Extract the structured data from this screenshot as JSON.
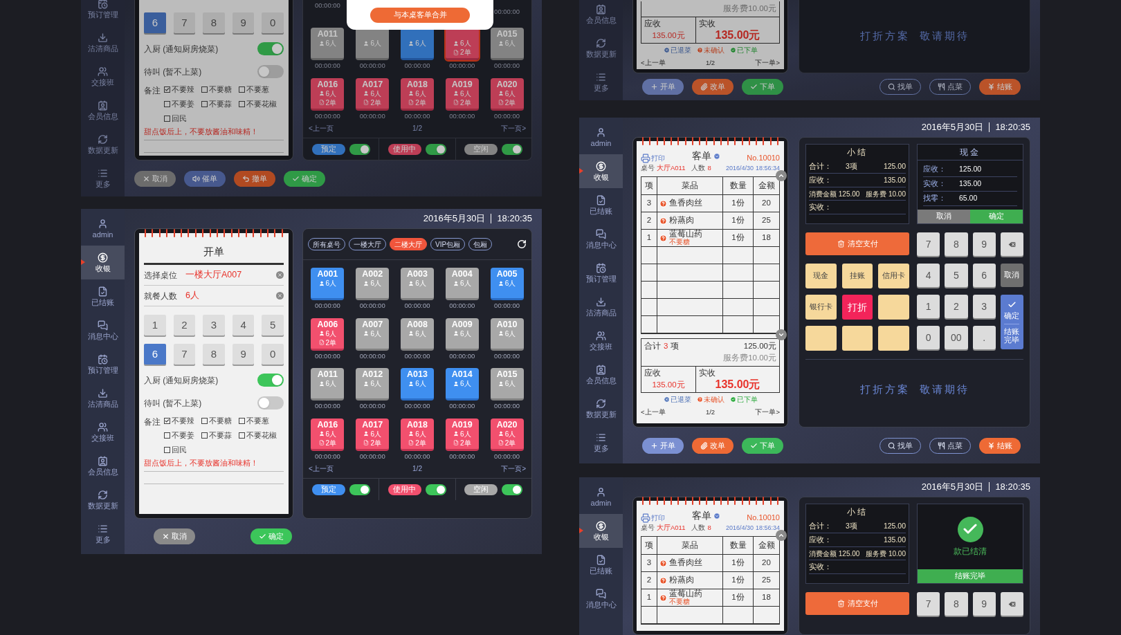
{
  "screens": [
    {
      "kind": "open_order",
      "dimmed": true,
      "sidebar": [
        {
          "kind": "reservation",
          "label": "预订管理",
          "selected": false
        },
        {
          "kind": "clean",
          "label": "沽清商品",
          "selected": false
        },
        {
          "kind": "shift",
          "label": "交接班",
          "selected": false
        },
        {
          "kind": "member",
          "label": "会员信息",
          "selected": false
        },
        {
          "kind": "sync",
          "label": "数据更新",
          "selected": false
        },
        {
          "kind": "more",
          "label": "更多",
          "selected": false
        }
      ],
      "form": {
        "keypad": [
          {
            "label": "6",
            "selected": true
          },
          {
            "label": "7",
            "selected": false
          },
          {
            "label": "8",
            "selected": false
          },
          {
            "label": "9",
            "selected": false
          },
          {
            "label": "0",
            "selected": false
          }
        ],
        "toggles": [
          {
            "label": "入厨 (通知厨房烧菜)",
            "on": true
          },
          {
            "label": "待叫 (暂不上菜)",
            "on": false
          }
        ],
        "remarks": {
          "label": "备注",
          "options": [
            {
              "label": "不要辣",
              "checked": true
            },
            {
              "label": "不要糖",
              "checked": false
            },
            {
              "label": "不要葱",
              "checked": false
            },
            {
              "label": "不要姜",
              "checked": false
            },
            {
              "label": "不要蒜",
              "checked": false
            },
            {
              "label": "不要花椒",
              "checked": false
            },
            {
              "label": "回民",
              "checked": false
            }
          ],
          "note": "甜点饭后上，不要放酱油和味精！"
        }
      },
      "grid": {
        "cut_row": {
          "left_timer": "00:00:00",
          "right_timer": "00:00:00"
        },
        "tiles": [
          {
            "code": "A011",
            "kind": "idle",
            "guests": "6人",
            "timer": "00:00:00",
            "selected": false
          },
          {
            "kind": "idle",
            "guests": "6人",
            "timer": "00:00:00",
            "selected": false
          },
          {
            "kind": "reserved",
            "guests": "6人",
            "timer": "00:00:00",
            "selected": false
          },
          {
            "kind": "in_use",
            "guests": "6人",
            "orders": "2单",
            "timer": "00:00:00",
            "selected": true
          },
          {
            "code": "A015",
            "kind": "idle",
            "guests": "6人",
            "timer": "00:00:00",
            "selected": false
          },
          {
            "code": "A016",
            "kind": "in_use",
            "guests": "6人",
            "orders": "2单",
            "timer": "00:00:00",
            "selected": false
          },
          {
            "code": "A017",
            "kind": "in_use",
            "guests": "6人",
            "orders": "2单",
            "timer": "00:00:00",
            "selected": false
          },
          {
            "code": "A018",
            "kind": "in_use",
            "guests": "6人",
            "orders": "2单",
            "timer": "00:00:00",
            "selected": false
          },
          {
            "code": "A019",
            "kind": "in_use",
            "guests": "6人",
            "orders": "2单",
            "timer": "00:00:00",
            "selected": false
          },
          {
            "code": "A020",
            "kind": "in_use",
            "guests": "6人",
            "orders": "2单",
            "timer": "00:00:00",
            "selected": false
          }
        ],
        "pager": {
          "prev": "<上一页",
          "page": "1/2",
          "next": "下一页>"
        },
        "legend": [
          {
            "kind": "reserved",
            "label": "预定",
            "on": true
          },
          {
            "kind": "in_use",
            "label": "使用中",
            "on": true
          },
          {
            "kind": "idle",
            "label": "空闲",
            "on": true
          }
        ],
        "popup": {
          "button": "与本桌客单合并"
        }
      },
      "actions": [
        {
          "kind": "cancel",
          "label": "取消"
        },
        {
          "kind": "urge",
          "label": "催单"
        },
        {
          "kind": "revoke",
          "label": "撤单"
        },
        {
          "kind": "confirm",
          "label": "确定"
        }
      ]
    },
    {
      "kind": "open_order",
      "dimmed": false,
      "header": {
        "date": "2016年5月30日",
        "time": "18:20:35"
      },
      "sidebar": [
        {
          "kind": "user",
          "label": "admin",
          "selected": false
        },
        {
          "kind": "cashier",
          "label": "收银",
          "selected": true
        },
        {
          "kind": "settled",
          "label": "已结账",
          "selected": false
        },
        {
          "kind": "messages",
          "label": "消息中心",
          "selected": false
        },
        {
          "kind": "reservation",
          "label": "预订管理",
          "selected": false
        },
        {
          "kind": "clean",
          "label": "沽清商品",
          "selected": false
        },
        {
          "kind": "shift",
          "label": "交接班",
          "selected": false
        },
        {
          "kind": "member",
          "label": "会员信息",
          "selected": false
        },
        {
          "kind": "sync",
          "label": "数据更新",
          "selected": false
        },
        {
          "kind": "more",
          "label": "更多",
          "selected": false
        }
      ],
      "form": {
        "title": "开单",
        "fields": [
          {
            "label": "选择桌位",
            "value": "一楼大厅A007"
          },
          {
            "label": "就餐人数",
            "value": "6人"
          }
        ],
        "keypad": [
          {
            "label": "1",
            "selected": false
          },
          {
            "label": "2",
            "selected": false
          },
          {
            "label": "3",
            "selected": false
          },
          {
            "label": "4",
            "selected": false
          },
          {
            "label": "5",
            "selected": false
          },
          {
            "label": "6",
            "selected": true
          },
          {
            "label": "7",
            "selected": false
          },
          {
            "label": "8",
            "selected": false
          },
          {
            "label": "9",
            "selected": false
          },
          {
            "label": "0",
            "selected": false
          }
        ],
        "toggles": [
          {
            "label": "入厨 (通知厨房烧菜)",
            "on": true
          },
          {
            "label": "待叫 (暂不上菜)",
            "on": false
          }
        ],
        "remarks": {
          "label": "备注",
          "options": [
            {
              "label": "不要辣",
              "checked": true
            },
            {
              "label": "不要糖",
              "checked": false
            },
            {
              "label": "不要葱",
              "checked": false
            },
            {
              "label": "不要姜",
              "checked": false
            },
            {
              "label": "不要蒜",
              "checked": false
            },
            {
              "label": "不要花椒",
              "checked": false
            },
            {
              "label": "回民",
              "checked": false
            }
          ],
          "note": "甜点饭后上，不要放酱油和味精！"
        }
      },
      "grid": {
        "tabs": [
          {
            "label": "所有桌号",
            "selected": false
          },
          {
            "label": "一楼大厅",
            "selected": false
          },
          {
            "label": "二楼大厅",
            "selected": true
          },
          {
            "label": "VIP包厢",
            "selected": false
          },
          {
            "label": "包厢",
            "selected": false
          }
        ],
        "tiles": [
          {
            "code": "A001",
            "kind": "reserved",
            "guests": "6人",
            "timer": "00:00:00",
            "selected": false
          },
          {
            "code": "A002",
            "kind": "idle",
            "guests": "6人",
            "timer": "00:00:00",
            "selected": false
          },
          {
            "code": "A003",
            "kind": "idle",
            "guests": "6人",
            "timer": "00:00:00",
            "selected": false
          },
          {
            "code": "A004",
            "kind": "idle",
            "guests": "6人",
            "timer": "00:00:00",
            "selected": false
          },
          {
            "code": "A005",
            "kind": "reserved",
            "guests": "6人",
            "timer": "00:00:00",
            "selected": false
          },
          {
            "code": "A006",
            "kind": "in_use",
            "guests": "6人",
            "orders": "2单",
            "timer": "00:00:00",
            "selected": false
          },
          {
            "code": "A007",
            "kind": "idle",
            "guests": "6人",
            "timer": "00:00:00",
            "selected": false
          },
          {
            "code": "A008",
            "kind": "idle",
            "guests": "6人",
            "timer": "00:00:00",
            "selected": false
          },
          {
            "code": "A009",
            "kind": "idle",
            "guests": "6人",
            "timer": "00:00:00",
            "selected": false
          },
          {
            "code": "A010",
            "kind": "idle",
            "guests": "6人",
            "timer": "00:00:00",
            "selected": false
          },
          {
            "code": "A011",
            "kind": "idle",
            "guests": "6人",
            "timer": "00:00:00",
            "selected": false
          },
          {
            "code": "A012",
            "kind": "idle",
            "guests": "6人",
            "timer": "00:00:00",
            "selected": false
          },
          {
            "code": "A013",
            "kind": "reserved",
            "guests": "6人",
            "timer": "00:00:00",
            "selected": false
          },
          {
            "code": "A014",
            "kind": "reserved",
            "guests": "6人",
            "timer": "00:00:00",
            "selected": false
          },
          {
            "code": "A015",
            "kind": "idle",
            "guests": "6人",
            "timer": "00:00:00",
            "selected": false
          },
          {
            "code": "A016",
            "kind": "in_use",
            "guests": "6人",
            "orders": "2单",
            "timer": "00:00:00",
            "selected": false
          },
          {
            "code": "A017",
            "kind": "in_use",
            "guests": "6人",
            "orders": "2单",
            "timer": "00:00:00",
            "selected": false
          },
          {
            "code": "A018",
            "kind": "in_use",
            "guests": "6人",
            "orders": "2单",
            "timer": "00:00:00",
            "selected": false
          },
          {
            "code": "A019",
            "kind": "in_use",
            "guests": "6人",
            "orders": "2单",
            "timer": "00:00:00",
            "selected": false
          },
          {
            "code": "A020",
            "kind": "in_use",
            "guests": "6人",
            "orders": "2单",
            "timer": "00:00:00",
            "selected": false
          }
        ],
        "pager": {
          "prev": "<上一页",
          "page": "1/2",
          "next": "下一页>"
        },
        "legend": [
          {
            "kind": "reserved",
            "label": "预定",
            "on": true
          },
          {
            "kind": "in_use",
            "label": "使用中",
            "on": true
          },
          {
            "kind": "idle",
            "label": "空闲",
            "on": true
          }
        ]
      },
      "actions": [
        {
          "kind": "cancel",
          "label": "取消"
        },
        {
          "kind": "confirm",
          "label": "确定"
        }
      ]
    },
    {
      "kind": "checkout",
      "dimmed": true,
      "sidebar": [
        {
          "kind": "member",
          "label": "会员信息",
          "selected": false
        },
        {
          "kind": "sync",
          "label": "数据更新",
          "selected": false
        },
        {
          "kind": "more",
          "label": "更多",
          "selected": false
        }
      ],
      "receipt": {
        "totals": {
          "service_fee": "服务费10.00元"
        },
        "due": {
          "label": "应收",
          "value": "135.00元"
        },
        "paid": {
          "label": "实收",
          "value": "135.00元"
        },
        "legend": [
          {
            "kind": "returned",
            "label": "已退菜"
          },
          {
            "kind": "unconfirmed",
            "label": "未确认"
          },
          {
            "kind": "ordered",
            "label": "已下单"
          }
        ],
        "pager": {
          "prev": "<上一单",
          "page": "1/2",
          "next": "下一单>"
        }
      },
      "promo": [
        "打折方案",
        "敬请期待"
      ],
      "actions_left": [
        {
          "kind": "new",
          "label": "开单"
        },
        {
          "kind": "edit",
          "label": "改单"
        },
        {
          "kind": "submit",
          "label": "下单"
        }
      ],
      "actions_right": [
        {
          "kind": "find",
          "label": "找单"
        },
        {
          "kind": "menu",
          "label": "点菜"
        },
        {
          "kind": "checkout",
          "label": "结账"
        }
      ]
    },
    {
      "kind": "checkout",
      "dimmed": false,
      "header": {
        "date": "2016年5月30日",
        "time": "18:20:35"
      },
      "sidebar": [
        {
          "kind": "user",
          "label": "admin",
          "selected": false
        },
        {
          "kind": "cashier",
          "label": "收银",
          "selected": true
        },
        {
          "kind": "settled",
          "label": "已结账",
          "selected": false
        },
        {
          "kind": "messages",
          "label": "消息中心",
          "selected": false
        },
        {
          "kind": "reservation",
          "label": "预订管理",
          "selected": false
        },
        {
          "kind": "clean",
          "label": "沽清商品",
          "selected": false
        },
        {
          "kind": "shift",
          "label": "交接班",
          "selected": false
        },
        {
          "kind": "member",
          "label": "会员信息",
          "selected": false
        },
        {
          "kind": "sync",
          "label": "数据更新",
          "selected": false
        },
        {
          "kind": "more",
          "label": "更多",
          "selected": false
        }
      ],
      "receipt": {
        "print": "打印",
        "title": "客单",
        "number": "No.10010",
        "meta": {
          "table_label": "桌号",
          "table": "大厅A011",
          "guests_label": "人数",
          "guests": "8",
          "date": "2016/4/30",
          "time": "18:56:34"
        },
        "columns": [
          "项",
          "菜品",
          "数量",
          "金额"
        ],
        "items": [
          {
            "kind": "unconfirmed",
            "index": "3",
            "name": "鱼香肉丝",
            "qty": "1份",
            "amount": "20"
          },
          {
            "kind": "unconfirmed",
            "index": "2",
            "name": "粉蒸肉",
            "qty": "1份",
            "amount": "25"
          },
          {
            "kind": "unconfirmed",
            "index": "1",
            "name": "蓝莓山药",
            "note": "不要糖",
            "qty": "1份",
            "amount": "18"
          },
          {
            "kind": "blank"
          },
          {
            "kind": "blank"
          },
          {
            "kind": "blank"
          },
          {
            "kind": "blank"
          },
          {
            "kind": "blank"
          }
        ],
        "totals": {
          "label": "合计",
          "count": "3",
          "unit": "项",
          "amount": "125.00元",
          "service_fee": "服务费10.00元"
        },
        "due": {
          "label": "应收",
          "value": "135.00元"
        },
        "paid": {
          "label": "实收",
          "value": "135.00元"
        },
        "legend": [
          {
            "kind": "returned",
            "label": "已退菜"
          },
          {
            "kind": "unconfirmed",
            "label": "未确认"
          },
          {
            "kind": "ordered",
            "label": "已下单"
          }
        ],
        "pager": {
          "prev": "<上一单",
          "page": "1/2",
          "next": "下一单>"
        }
      },
      "summary": {
        "title": "小结",
        "rows": [
          {
            "kind": "main",
            "label": "合计：",
            "count": "3项",
            "value": "125.00"
          },
          {
            "kind": "main",
            "label": "应收：",
            "value": "135.00"
          },
          {
            "kind": "detail",
            "label": "消费金额 125.00",
            "value": "服务费 10.00"
          },
          {
            "kind": "main",
            "label": "实收："
          }
        ]
      },
      "payment_panel": {
        "kind": "cash",
        "title": "现金",
        "rows": [
          {
            "label": "应收：",
            "value": "125.00"
          },
          {
            "label": "实收：",
            "value": "135.00"
          },
          {
            "label": "找零：",
            "value": "65.00"
          }
        ],
        "cancel": "取消",
        "confirm": "确定"
      },
      "clear_button": "清空支付",
      "pay_methods": [
        {
          "label": "现金",
          "selected": false
        },
        {
          "label": "挂账",
          "selected": false
        },
        {
          "label": "信用卡",
          "selected": false
        },
        {
          "label": "银行卡",
          "selected": false
        },
        {
          "label": "打折",
          "selected": true
        },
        {
          "selected": false
        },
        {
          "selected": false
        },
        {
          "selected": false
        },
        {
          "selected": false
        }
      ],
      "numpad": [
        {
          "kind": "digit",
          "label": "7"
        },
        {
          "kind": "digit",
          "label": "8"
        },
        {
          "kind": "digit",
          "label": "9"
        },
        {
          "kind": "backspace"
        },
        {
          "kind": "digit",
          "label": "4"
        },
        {
          "kind": "digit",
          "label": "5"
        },
        {
          "kind": "digit",
          "label": "6"
        },
        {
          "kind": "cancel",
          "label": "取消"
        },
        {
          "kind": "digit",
          "label": "1"
        },
        {
          "kind": "digit",
          "label": "2"
        },
        {
          "kind": "digit",
          "label": "3"
        },
        {
          "kind": "digit",
          "label": "0"
        },
        {
          "kind": "digit",
          "label": "00"
        },
        {
          "kind": "digit",
          "label": "."
        },
        {
          "kind": "confirm",
          "label": "确定",
          "sublabel": "结账完毕"
        }
      ],
      "promo": [
        "打折方案",
        "敬请期待"
      ],
      "actions_left": [
        {
          "kind": "new",
          "label": "开单"
        },
        {
          "kind": "edit",
          "label": "改单"
        },
        {
          "kind": "submit",
          "label": "下单"
        }
      ],
      "actions_right": [
        {
          "kind": "find",
          "label": "找单"
        },
        {
          "kind": "menu",
          "label": "点菜"
        },
        {
          "kind": "checkout",
          "label": "结账"
        }
      ]
    },
    {
      "kind": "checkout",
      "dimmed": false,
      "header": {
        "date": "2016年5月30日",
        "time": "18:20:35"
      },
      "sidebar": [
        {
          "kind": "user",
          "label": "admin",
          "selected": false
        },
        {
          "kind": "cashier",
          "label": "收银",
          "selected": true
        },
        {
          "kind": "settled",
          "label": "已结账",
          "selected": false
        },
        {
          "kind": "messages",
          "label": "消息中心",
          "selected": false
        }
      ],
      "receipt": {
        "print": "打印",
        "title": "客单",
        "number": "No.10010",
        "meta": {
          "table_label": "桌号",
          "table": "大厅A011",
          "guests_label": "人数",
          "guests": "8",
          "date": "2016/4/30",
          "time": "18:56:34"
        },
        "columns": [
          "项",
          "菜品",
          "数量",
          "金额"
        ],
        "items": [
          {
            "kind": "unconfirmed",
            "index": "3",
            "name": "鱼香肉丝",
            "qty": "1份",
            "amount": "20"
          },
          {
            "kind": "unconfirmed",
            "index": "2",
            "name": "粉蒸肉",
            "qty": "1份",
            "amount": "25"
          },
          {
            "kind": "unconfirmed",
            "index": "1",
            "name": "蓝莓山药",
            "note": "不要糖",
            "qty": "1份",
            "amount": "18"
          },
          {
            "kind": "blank"
          }
        ]
      },
      "summary": {
        "title": "小结",
        "rows": [
          {
            "kind": "main",
            "label": "合计：",
            "count": "3项",
            "value": "125.00"
          },
          {
            "kind": "main",
            "label": "应收：",
            "value": "135.00"
          },
          {
            "kind": "detail",
            "label": "消费金额 125.00",
            "value": "服务费 10.00"
          },
          {
            "kind": "main",
            "label": "实收："
          }
        ]
      },
      "payment_panel": {
        "kind": "paid",
        "message": "款已结清",
        "bar": "结账完毕"
      },
      "clear_button": "清空支付",
      "numpad": [
        {
          "kind": "digit",
          "label": "7"
        },
        {
          "kind": "digit",
          "label": "8"
        },
        {
          "kind": "digit",
          "label": "9"
        },
        {
          "kind": "backspace"
        }
      ]
    }
  ]
}
